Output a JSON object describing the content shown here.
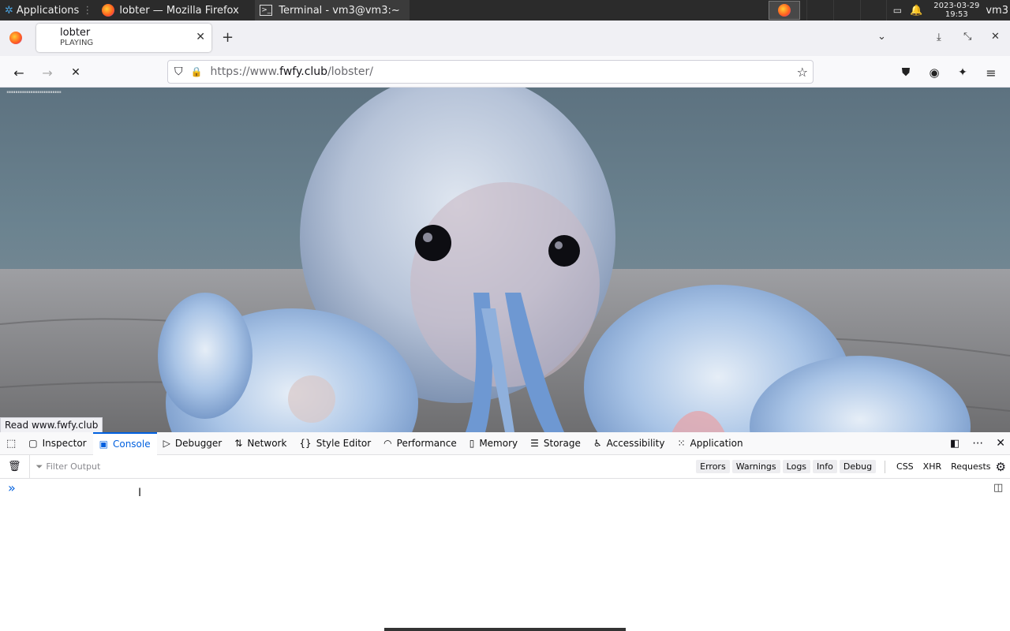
{
  "taskbar": {
    "apps_label": "Applications",
    "window_firefox": "lobter — Mozilla Firefox",
    "window_terminal": "Terminal - vm3@vm3:~",
    "clock_date": "2023-03-29",
    "clock_time": "19:53",
    "user": "vm3"
  },
  "browser": {
    "tab_title": "lobter",
    "tab_subtitle": "PLAYING",
    "url_prefix": "https://www.",
    "url_host": "fwfy.club",
    "url_path": "/lobster/",
    "status_text": "Read www.fwfy.club",
    "page_overlay_text": "\"\"\"\"\"\"\"\"\"\"\"\"\"\"\"\"\"\"\"\"\"\""
  },
  "devtools": {
    "tabs": [
      "Inspector",
      "Console",
      "Debugger",
      "Network",
      "Style Editor",
      "Performance",
      "Memory",
      "Storage",
      "Accessibility",
      "Application"
    ],
    "filter_placeholder": "Filter Output",
    "levels": [
      "Errors",
      "Warnings",
      "Logs",
      "Info",
      "Debug"
    ],
    "extras": [
      "CSS",
      "XHR",
      "Requests"
    ],
    "prompt": "»"
  },
  "colors": {
    "accent": "#0060df",
    "taskbar": "#2b2b2b"
  }
}
